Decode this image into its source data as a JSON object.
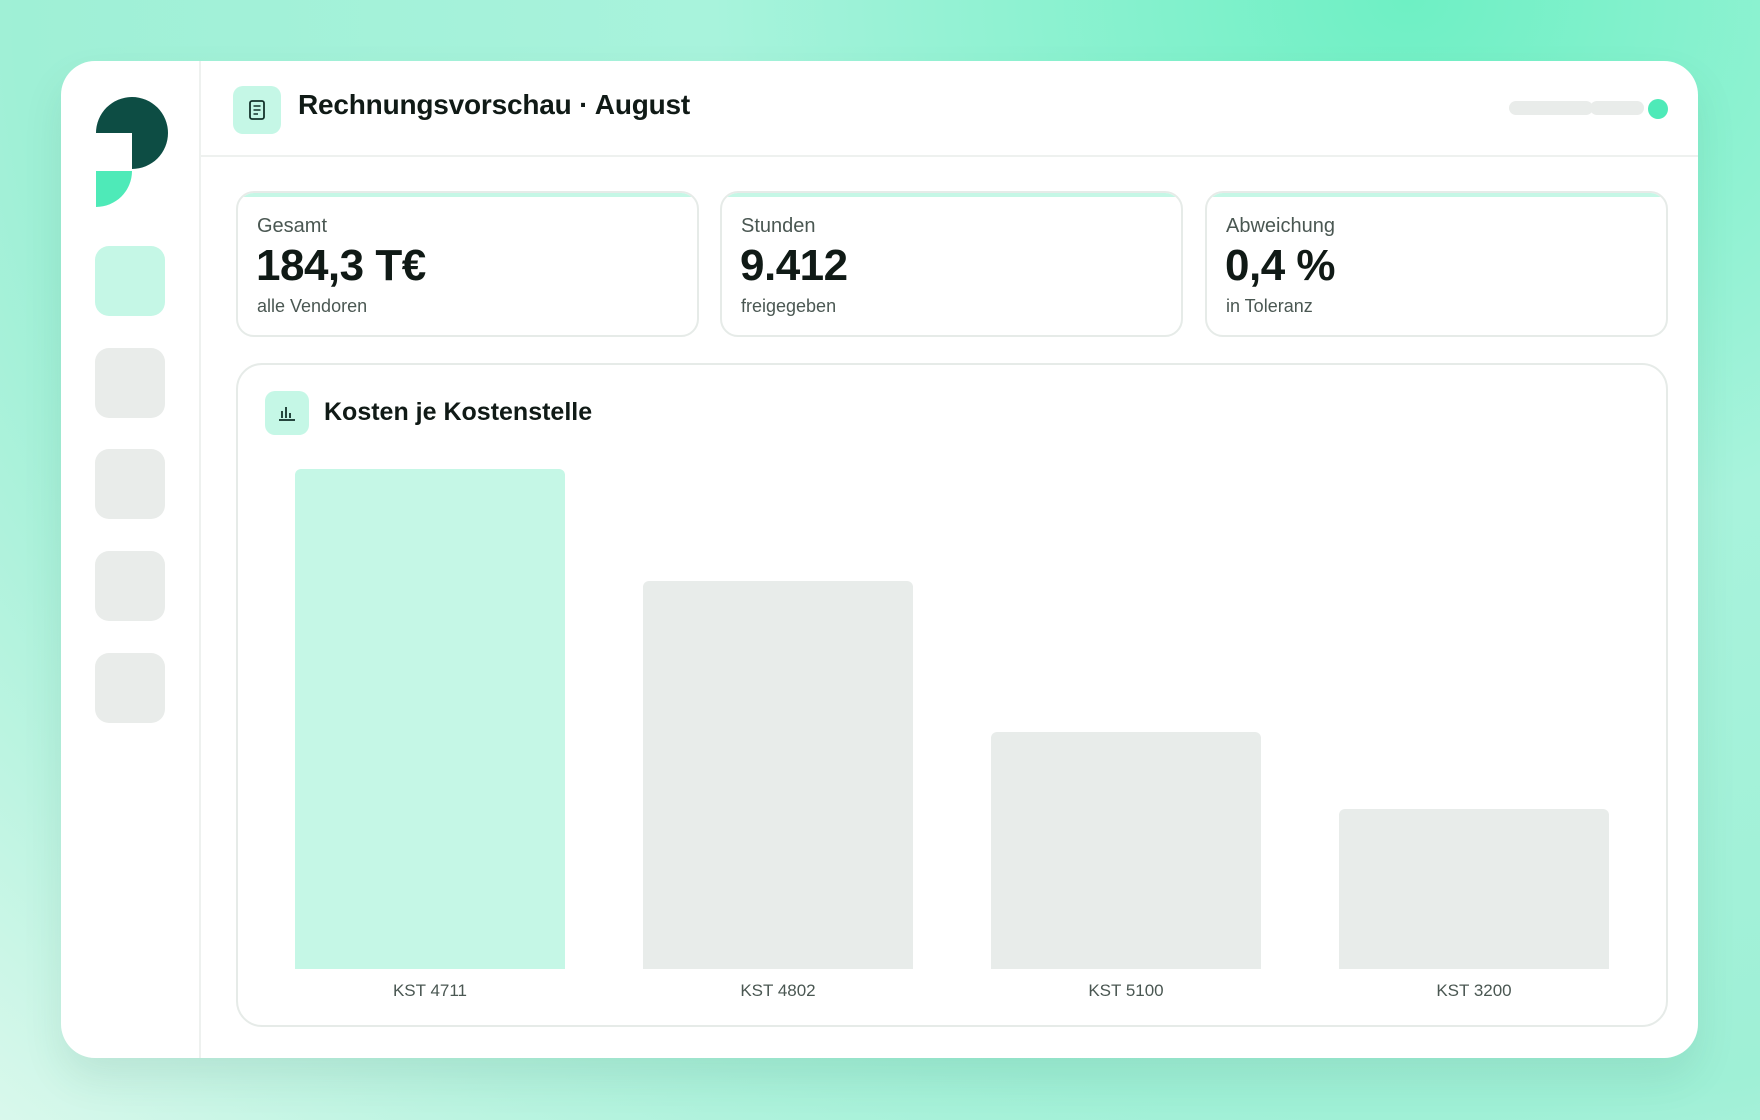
{
  "header": {
    "title": "Rechnungsvorschau · August",
    "doc_icon": "document-icon",
    "status_color": "#4eeab8"
  },
  "sidebar": {
    "logo": "brand-logo",
    "items": [
      {
        "icon": "nav-item-1",
        "active": true
      },
      {
        "icon": "nav-item-2",
        "active": false
      },
      {
        "icon": "nav-item-3",
        "active": false
      },
      {
        "icon": "nav-item-4",
        "active": false
      },
      {
        "icon": "nav-item-5",
        "active": false
      }
    ]
  },
  "kpis": [
    {
      "label": "Gesamt",
      "value": "184,3 T€",
      "sub": "alle Vendoren"
    },
    {
      "label": "Stunden",
      "value": "9.412",
      "sub": "freigegeben"
    },
    {
      "label": "Abweichung",
      "value": "0,4 %",
      "sub": "in Toleranz"
    }
  ],
  "chart": {
    "title": "Kosten je Kostenstelle",
    "icon": "bar-chart-icon"
  },
  "chart_data": {
    "type": "bar",
    "title": "Kosten je Kostenstelle",
    "categories": [
      "KST 4711",
      "KST 4802",
      "KST 5100",
      "KST 3200"
    ],
    "values": [
      100,
      77.5,
      47.3,
      32
    ],
    "highlight_index": 0,
    "ylim": [
      0,
      100
    ],
    "grid": false,
    "colors": {
      "highlight": "#c5f7e6",
      "default": "#e8ecea"
    }
  },
  "colors": {
    "accent": "#4eeab8",
    "accent_light": "#c5f7e6",
    "brand_dark": "#0d4d44"
  }
}
